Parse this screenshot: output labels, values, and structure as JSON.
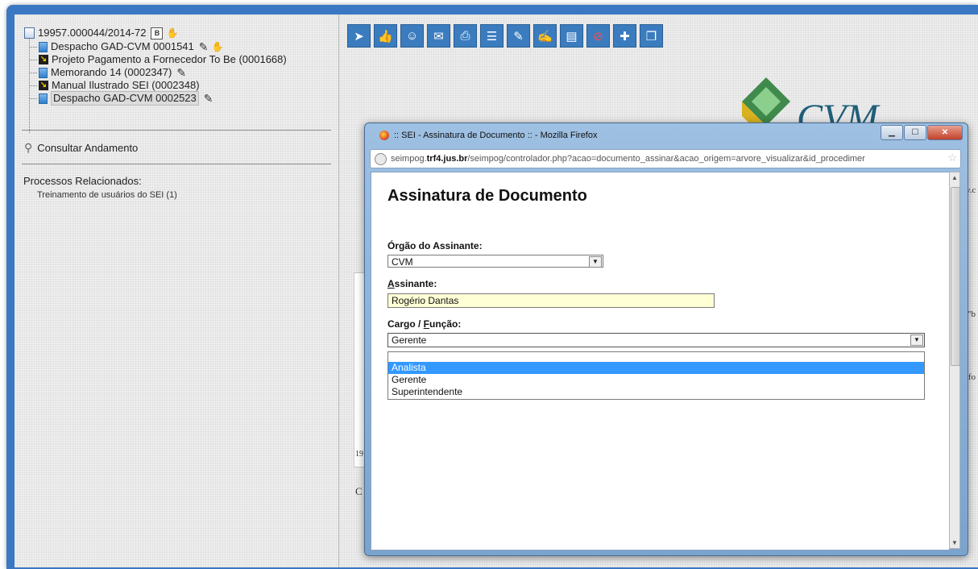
{
  "tree": {
    "process_id": "19957.000044/2014-72",
    "process_badge": "B",
    "items": [
      {
        "label": "Despacho GAD-CVM 0001541",
        "type": "doc",
        "pen": true,
        "hand": true
      },
      {
        "label": "Projeto Pagamento a Fornecedor To Be (0001668)",
        "type": "ext"
      },
      {
        "label": "Memorando 14 (0002347)",
        "type": "doc",
        "pen": true
      },
      {
        "label": "Manual Ilustrado SEI (0002348)",
        "type": "ext"
      },
      {
        "label": "Despacho GAD-CVM 0002523",
        "type": "doc",
        "pen": true,
        "selected": true
      }
    ]
  },
  "consultar": {
    "label": "Consultar Andamento",
    "icon": "key-icon"
  },
  "related": {
    "title": "Processos Relacionados:",
    "items": [
      "Treinamento de usuários do SEI (1)"
    ]
  },
  "toolbar": {
    "buttons": [
      "send-process-icon",
      "thumbs-up-icon",
      "users-icon",
      "email-icon",
      "print-icon",
      "scroll-icon",
      "pen-icon",
      "sign-icon",
      "notebook-icon",
      "cancel-icon",
      "new-doc-icon",
      "copy-icon"
    ]
  },
  "background_fragments": {
    "logo_text": "CVM",
    "frag1": "19",
    "frag2": "C",
    "frag3": "v.c",
    "frag4": "\"b",
    "frag5": "afo"
  },
  "popup": {
    "window_title": ":: SEI - Assinatura de Documento :: - Mozilla Firefox",
    "url_prefix": "seimpog.",
    "url_domain": "trf4.jus.br",
    "url_rest": "/seimpog/controlador.php?acao=documento_assinar&acao_origem=arvore_visualizar&id_procedimer",
    "heading": "Assinatura de Documento",
    "orgao_label": "Órgão do Assinante:",
    "orgao_value": "CVM",
    "assinante_label_first": "A",
    "assinante_label_rest": "ssinante:",
    "assinante_value": "Rogério Dantas",
    "cargo_label_prefix": "Cargo / ",
    "cargo_label_first": "F",
    "cargo_label_rest": "unção:",
    "cargo_value": "Gerente",
    "cargo_options": [
      "Analista",
      "Gerente",
      "Superintendente"
    ],
    "highlighted_option": "Analista"
  },
  "colors": {
    "frame_blue": "#3a78c4",
    "toolbar_button": "#3b7cbf",
    "highlight": "#3399ff",
    "input_bg": "#ffffd6"
  }
}
